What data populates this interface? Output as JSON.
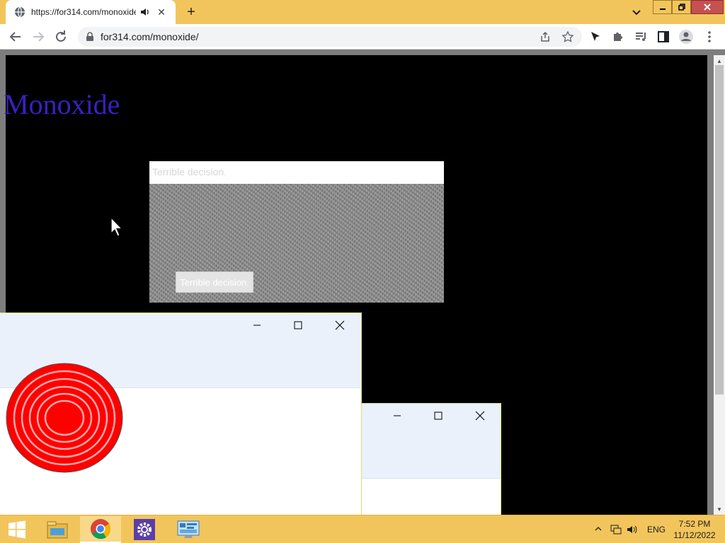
{
  "browser": {
    "tab": {
      "title": "https://for314.com/monoxide/",
      "close_glyph": "✕"
    },
    "new_tab_glyph": "+",
    "address": {
      "url": "for314.com/monoxide/"
    },
    "colors": {
      "frame": "#f2c55c",
      "close": "#c75050"
    }
  },
  "page": {
    "title": "Monoxide",
    "title_color": "#3b1fc4",
    "background": "#000000"
  },
  "dialog": {
    "title": "Terrible decision.",
    "button_label": "Terrible decision."
  },
  "fake_windows": [
    {
      "controls": [
        "minimize",
        "maximize",
        "close"
      ],
      "content_icon": "red-concentric-target-icon"
    },
    {
      "controls": [
        "minimize",
        "maximize",
        "close"
      ]
    }
  ],
  "taskbar": {
    "apps": [
      "windows-start-icon",
      "file-explorer-icon",
      "chrome-icon",
      "settings-icon",
      "control-panel-icon"
    ],
    "language": "ENG",
    "time": "7:52 PM",
    "date": "11/12/2022"
  }
}
